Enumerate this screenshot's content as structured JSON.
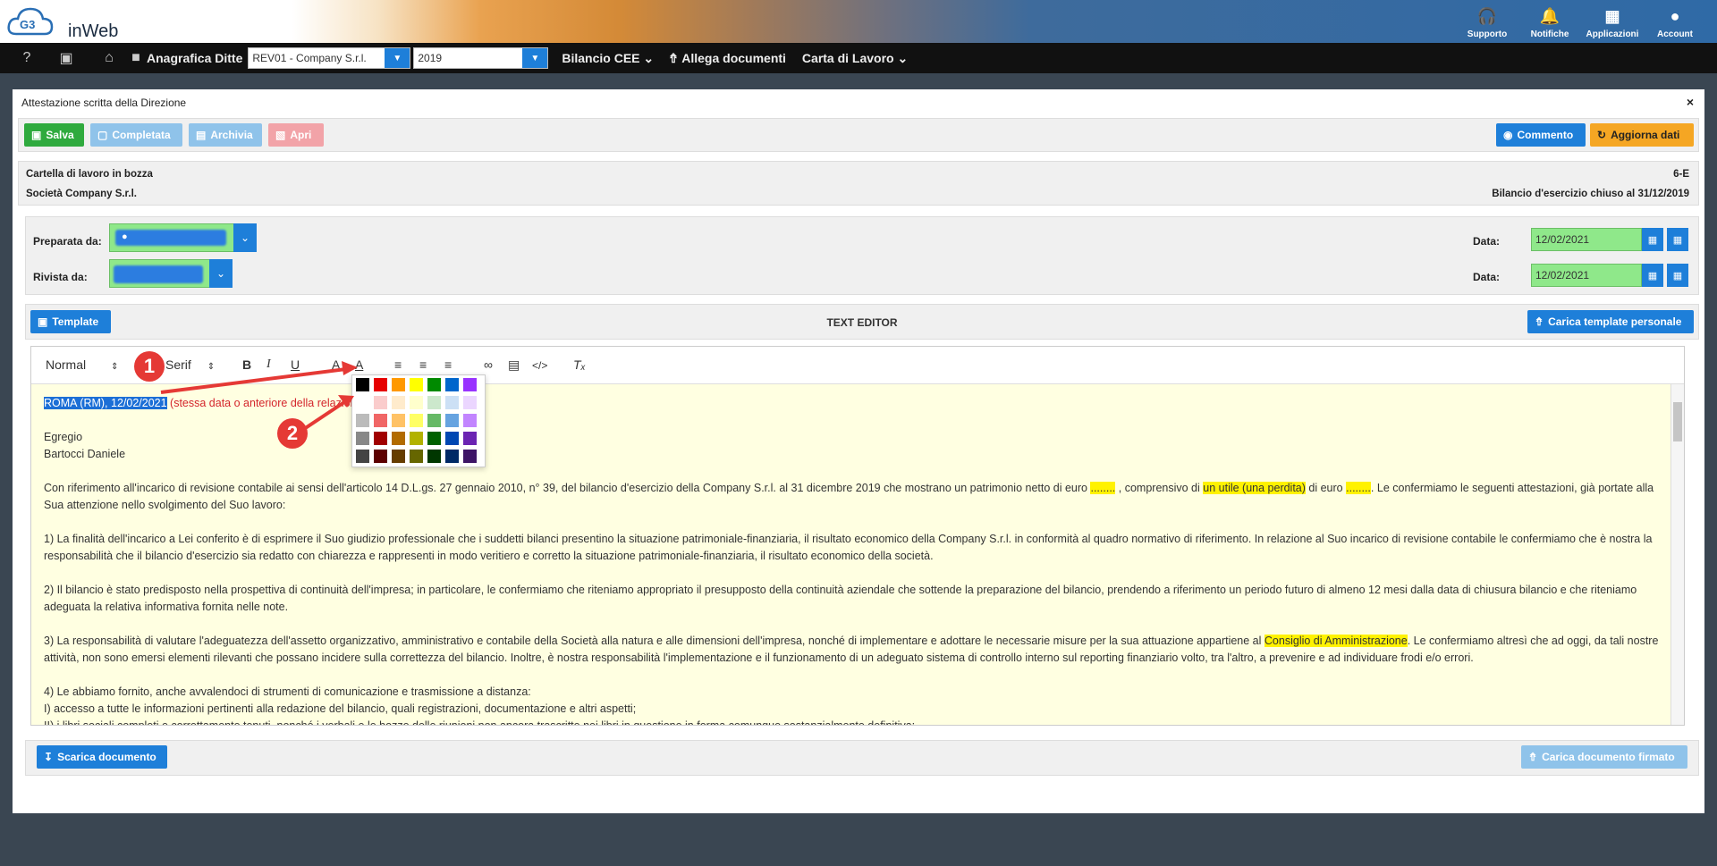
{
  "app": {
    "logo_text": "inWeb"
  },
  "top_icons": [
    {
      "label": "Supporto",
      "icon": "headphones-icon"
    },
    {
      "label": "Notifiche",
      "icon": "bell-icon"
    },
    {
      "label": "Applicazioni",
      "icon": "grid-icon"
    },
    {
      "label": "Account",
      "icon": "user-icon"
    }
  ],
  "navbar": {
    "anagrafica": "Anagrafica Ditte",
    "company_select": "REV01 - Company S.r.l.",
    "year_select": "2019",
    "bilancio": "Bilancio CEE",
    "allega": "Allega documenti",
    "carta": "Carta di Lavoro"
  },
  "panel": {
    "title": "Attestazione scritta della Direzione",
    "close": "×"
  },
  "actions": {
    "salva": "Salva",
    "completata": "Completata",
    "archivia": "Archivia",
    "apri": "Apri",
    "commento": "Commento",
    "aggiorna": "Aggiorna dati"
  },
  "info": {
    "status": "Cartella di lavoro in bozza",
    "company": "Società Company S.r.l.",
    "code": "6-E",
    "bilancio": "Bilancio d'esercizio chiuso al 31/12/2019"
  },
  "fields": {
    "preparata_label": "Preparata da:",
    "rivista_label": "Rivista da:",
    "data_label": "Data:",
    "data1": "12/02/2021",
    "data2": "12/02/2021"
  },
  "editor_bar": {
    "template": "Template",
    "title": "TEXT EDITOR",
    "carica": "Carica template personale"
  },
  "toolbar": {
    "format": "Normal",
    "font": "Serif"
  },
  "content": {
    "line1_selected": "ROMA (RM), 12/02/2021",
    "line1_red": "(stessa data o anteriore della relazione)",
    "egregio": "Egregio",
    "name": "Bartocci Daniele",
    "p1_a": "Con riferimento all'incarico di revisione contabile ai sensi dell'articolo 14 D.L.gs. 27 gennaio 2010, n° 39, del bilancio d'esercizio della Company S.r.l. al 31 dicembre 2019 che mostrano un patrimonio netto di euro",
    "p1_blank1": "........",
    "p1_b": ", comprensivo di",
    "p1_hl": "un utile (una perdita)",
    "p1_c": "di euro",
    "p1_blank2": "........",
    "p1_d": ". Le confermiamo le seguenti attestazioni, già portate alla Sua attenzione nello svolgimento del Suo lavoro:",
    "p2": "1) La finalità dell'incarico a Lei conferito è di esprimere il Suo giudizio professionale che i suddetti bilanci presentino la situazione patrimoniale-finanziaria, il risultato economico della Company S.r.l. in conformità al quadro normativo di riferimento. In relazione al Suo incarico di revisione contabile le confermiamo che è nostra la responsabilità che il bilancio d'esercizio sia redatto con chiarezza e rappresenti in modo veritiero e corretto la situazione patrimoniale-finanziaria, il risultato economico della società.",
    "p3": "2) Il bilancio è stato predisposto nella prospettiva di continuità dell'impresa; in particolare, le confermiamo che riteniamo appropriato il presupposto della continuità aziendale che sottende la preparazione del bilancio, prendendo a riferimento un periodo futuro di almeno 12 mesi dalla data di chiusura bilancio e che riteniamo adeguata la relativa informativa fornita nelle note.",
    "p4_a": "3) La responsabilità di valutare l'adeguatezza dell'assetto organizzativo, amministrativo e contabile della Società alla natura e alle dimensioni dell'impresa, nonché di implementare e adottare le necessarie misure per la sua attuazione appartiene al",
    "p4_hl": "Consiglio di Amministrazione",
    "p4_b": ". Le confermiamo altresì che ad oggi, da tali nostre attività, non sono emersi elementi rilevanti che possano incidere sulla correttezza del bilancio. Inoltre, è nostra responsabilità l'implementazione e il funzionamento di un adeguato sistema di controllo interno sul reporting finanziario volto, tra l'altro, a prevenire e ad individuare frodi e/o errori.",
    "p5": "4) Le abbiamo fornito, anche avvalendoci di strumenti di comunicazione e trasmissione a distanza:",
    "p5_i": "I)  accesso a tutte le informazioni pertinenti alla redazione del bilancio, quali registrazioni, documentazione e altri aspetti;",
    "p5_ii": "II) i libri sociali completi e correttamente tenuti, nonché i verbali e le bozze delle riunioni non ancora trascritte nei libri in questione in forma comunque sostanzialmente definitiva;"
  },
  "palette": {
    "colors": [
      [
        "#000000",
        "#e60000",
        "#ff9900",
        "#ffff00",
        "#008a00",
        "#0066cc",
        "#9933ff"
      ],
      [
        "#ffffff",
        "#facccc",
        "#ffebcc",
        "#ffffcc",
        "#cce8cc",
        "#cce0f5",
        "#ebd6ff"
      ],
      [
        "#bbbbbb",
        "#f06666",
        "#ffc266",
        "#ffff66",
        "#66b966",
        "#66a3e0",
        "#c285ff"
      ],
      [
        "#888888",
        "#a10000",
        "#b26b00",
        "#b2b200",
        "#006100",
        "#0047b2",
        "#6b24b2"
      ],
      [
        "#444444",
        "#5c0000",
        "#663d00",
        "#666600",
        "#003700",
        "#002966",
        "#3d1466"
      ]
    ]
  },
  "markers": {
    "m1": "1",
    "m2": "2"
  },
  "footer": {
    "scarica": "Scarica documento",
    "carica_firmato": "Carica documento firmato"
  }
}
